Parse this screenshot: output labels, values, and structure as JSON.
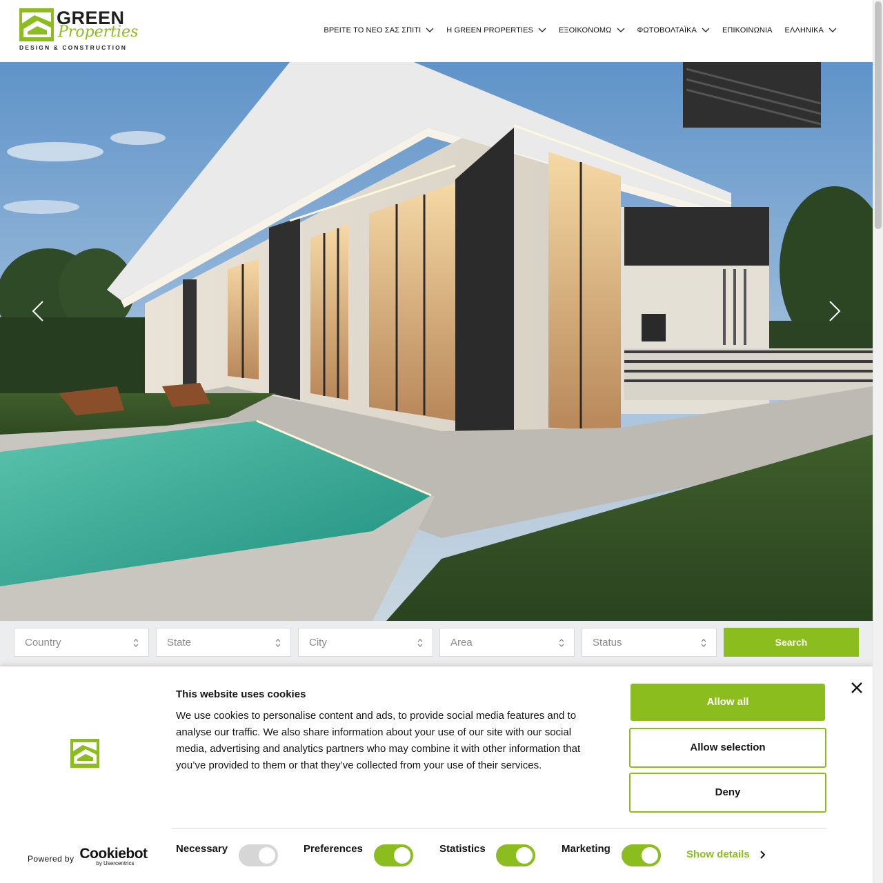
{
  "brand": {
    "name_line1": "GREEN",
    "name_line2": "Properties",
    "tagline": "DESIGN & CONSTRUCTION",
    "accent_color": "#8cbd1f"
  },
  "nav": {
    "items": [
      {
        "label": "ΒΡΕΙΤΕ ΤΟ ΝΕΟ ΣΑΣ ΣΠΙΤΙ",
        "has_dropdown": true
      },
      {
        "label": "Η GREEN PROPERTIES",
        "has_dropdown": true
      },
      {
        "label": "ΕΞΟΙΚΟΝΟΜΩ",
        "has_dropdown": true
      },
      {
        "label": "ΦΩΤΟΒΟΛΤΑΪΚΑ",
        "has_dropdown": true
      },
      {
        "label": "ΕΠΙΚΟΙΝΩΝΙΑ",
        "has_dropdown": false
      },
      {
        "label": "ΕΛΛΗΝΙΚΑ",
        "has_dropdown": true
      }
    ]
  },
  "hero": {
    "prev_icon": "chevron-left-icon",
    "next_icon": "chevron-right-icon"
  },
  "search": {
    "filters": [
      {
        "placeholder": "Country"
      },
      {
        "placeholder": "State"
      },
      {
        "placeholder": "City"
      },
      {
        "placeholder": "Area"
      },
      {
        "placeholder": "Status"
      }
    ],
    "button_label": "Search"
  },
  "cookie": {
    "title": "This website uses cookies",
    "text": "We use cookies to personalise content and ads, to provide social media features and to analyse our traffic. We also share information about your use of our site with our social media, advertising and analytics partners who may combine it with other information that you’ve provided to them or that they’ve collected from your use of their services.",
    "allow_all": "Allow all",
    "allow_selection": "Allow selection",
    "deny": "Deny",
    "powered_by": "Powered by",
    "cookiebot": "Cookiebot",
    "cookiebot_sub": "by Usercentrics",
    "toggles": [
      {
        "label": "Necessary",
        "on": true,
        "disabled": true
      },
      {
        "label": "Preferences",
        "on": true,
        "disabled": false
      },
      {
        "label": "Statistics",
        "on": true,
        "disabled": false
      },
      {
        "label": "Marketing",
        "on": true,
        "disabled": false
      }
    ],
    "show_details": "Show details"
  }
}
